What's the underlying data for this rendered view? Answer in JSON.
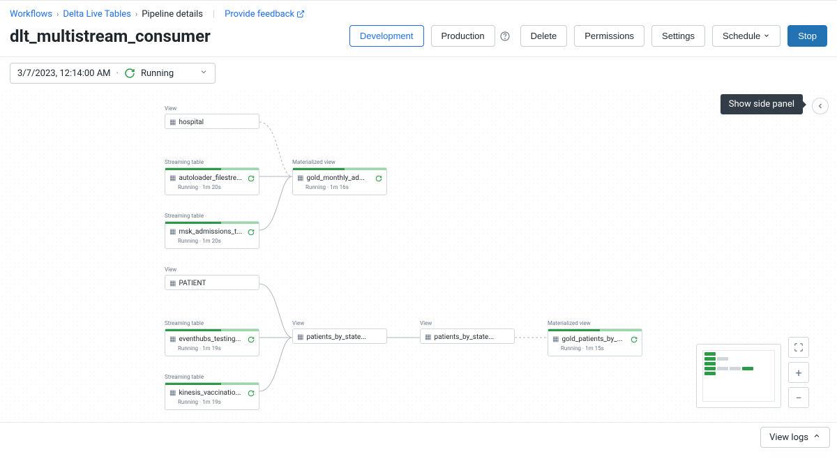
{
  "breadcrumb": {
    "items": [
      "Workflows",
      "Delta Live Tables"
    ],
    "current": "Pipeline details",
    "feedback": "Provide feedback"
  },
  "title": "dlt_multistream_consumer",
  "actions": {
    "development": "Development",
    "production": "Production",
    "delete": "Delete",
    "permissions": "Permissions",
    "settings": "Settings",
    "schedule": "Schedule",
    "stop": "Stop"
  },
  "run_selector": {
    "timestamp": "3/7/2023, 12:14:00 AM",
    "status": "Running"
  },
  "tooltip": "Show side panel",
  "logbar": "View logs",
  "node_types": {
    "view": "View",
    "streaming": "Streaming table",
    "materialized": "Materialized view"
  },
  "nodes": {
    "hospital": {
      "name": "hospital"
    },
    "auto": {
      "name": "autoloader_filestre...",
      "status": "Running · 1m 20s"
    },
    "msk": {
      "name": "msk_admissions_t...",
      "status": "Running · 1m 20s"
    },
    "gold_mon": {
      "name": "gold_monthly_ad...",
      "status": "Running · 1m 16s"
    },
    "patient": {
      "name": "PATIENT"
    },
    "eventhubs": {
      "name": "eventhubs_testing...",
      "status": "Running · 1m 19s"
    },
    "kinesis": {
      "name": "kinesis_vaccinatio...",
      "status": "Running · 1m 19s"
    },
    "pbs1": {
      "name": "patients_by_state..."
    },
    "pbs2": {
      "name": "patients_by_state..."
    },
    "gold_pat": {
      "name": "gold_patients_by_...",
      "status": "Running · 1m 15s"
    }
  }
}
